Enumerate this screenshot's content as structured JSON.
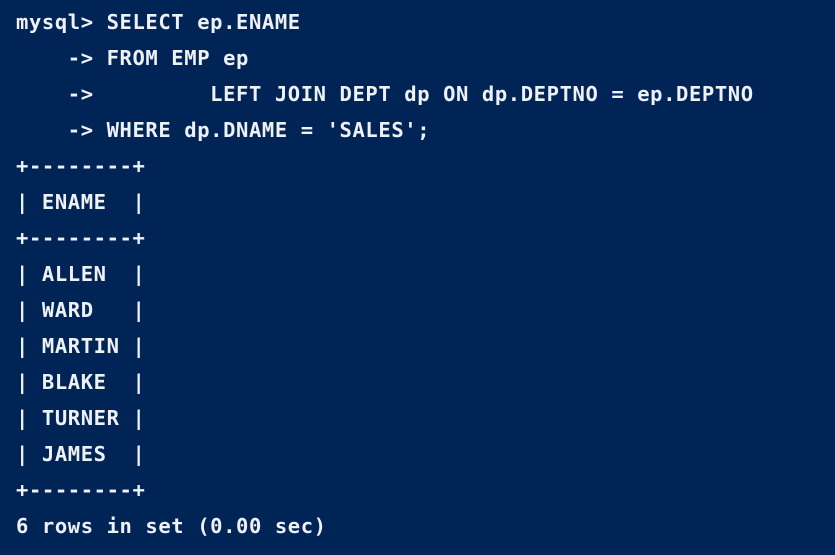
{
  "terminal": {
    "query_lines": [
      "mysql> SELECT ep.ENAME",
      "    -> FROM EMP ep",
      "    ->         LEFT JOIN DEPT dp ON dp.DEPTNO = ep.DEPTNO",
      "    -> WHERE dp.DNAME = 'SALES';"
    ],
    "table": {
      "border": "+--------+",
      "header": "| ENAME  |",
      "rows": [
        "| ALLEN  |",
        "| WARD   |",
        "| MARTIN |",
        "| BLAKE  |",
        "| TURNER |",
        "| JAMES  |"
      ]
    },
    "result_summary": "6 rows in set (0.00 sec)"
  },
  "colors": {
    "background": "#012456",
    "foreground": "#eef1f6"
  }
}
